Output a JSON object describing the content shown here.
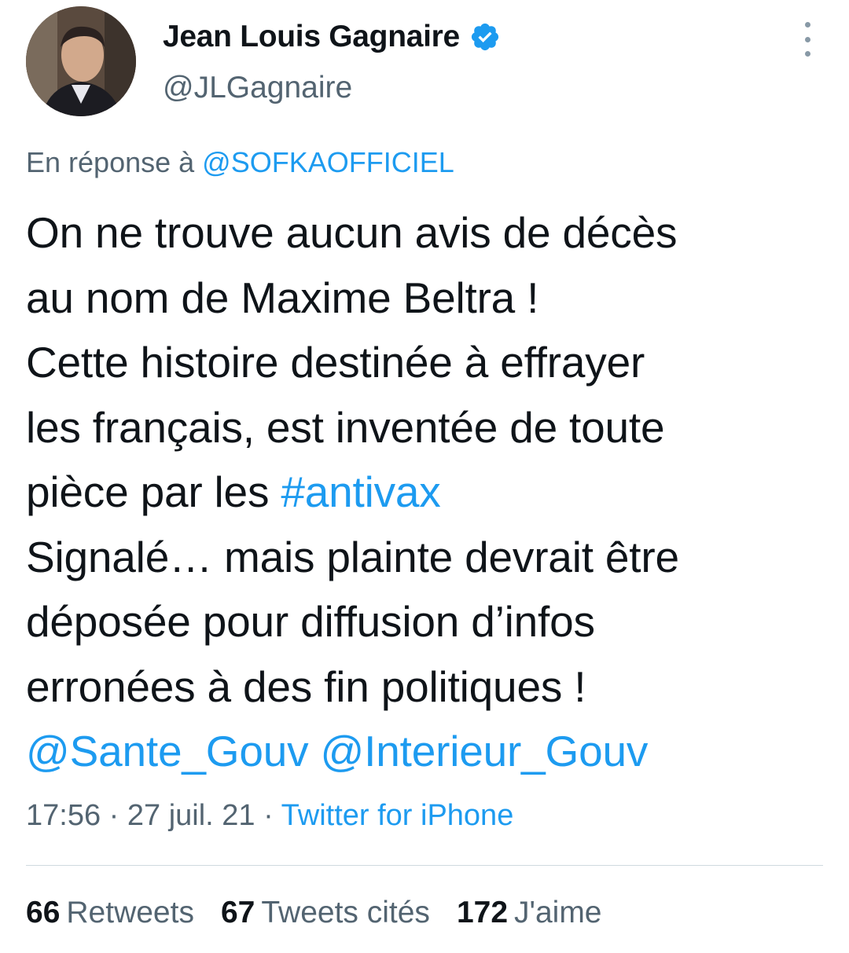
{
  "author": {
    "name": "Jean Louis Gagnaire",
    "handle": "@JLGagnaire",
    "verified_icon": "verified-badge-icon"
  },
  "reply": {
    "prefix": "En réponse à",
    "mention": "@SOFKAOFFICIEL"
  },
  "tweet": {
    "line1": "On ne trouve aucun avis de décès",
    "line2": "au nom de Maxime Beltra !",
    "line3": "Cette histoire destinée à effrayer",
    "line4": "les français, est inventée de toute",
    "line5_text": "pièce par les ",
    "hashtag": "#antivax",
    "line6": "Signalé… mais plainte devrait être",
    "line7": "déposée pour diffusion d’infos",
    "line8": "erronées à des fin politiques !",
    "mention1": "@Sante_Gouv",
    "mention2": "@Interieur_Gouv"
  },
  "meta": {
    "time": "17:56",
    "sep": "·",
    "date": "27 juil. 21",
    "source": "Twitter for iPhone"
  },
  "stats": {
    "retweets_count": "66",
    "retweets_label": "Retweets",
    "quotes_count": "67",
    "quotes_label": "Tweets cités",
    "likes_count": "172",
    "likes_label": "J'aime"
  },
  "colors": {
    "accent": "#1d9bf0",
    "secondary_text": "#536471",
    "primary_text": "#0f1419"
  }
}
